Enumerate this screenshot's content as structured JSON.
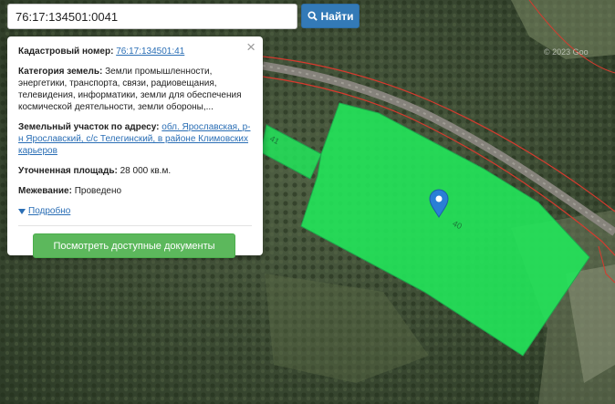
{
  "search": {
    "value": "76:17:134501:0041",
    "button_label": "Найти"
  },
  "popup": {
    "cadastral_label": "Кадастровый номер:",
    "cadastral_number": "76:17:134501:41",
    "category_label": "Категория земель:",
    "category_value": "Земли промышленности, энергетики, транспорта, связи, радиовещания, телевидения, информатики, земли для обеспечения космической деятельности, земли обороны,...",
    "address_label": "Земельный участок по адресу:",
    "address_value": "обл. Ярославская, р-н Ярославский, с/с Телегинский, в районе Климовских карьеров",
    "area_label": "Уточненная площадь:",
    "area_value": "28 000 кв.м.",
    "survey_label": "Межевание:",
    "survey_value": "Проведено",
    "details_link": "Подробно",
    "docs_button": "Посмотреть доступные документы",
    "close_glyph": "×"
  },
  "map": {
    "copyright": "© 2023 Goo",
    "parcel_labels": [
      "41",
      "40"
    ],
    "colors": {
      "parcel_fill": "#22e55a",
      "boundary_line": "#d83a2e",
      "road": "#8a8680",
      "marker": "#2a7fd6"
    }
  }
}
